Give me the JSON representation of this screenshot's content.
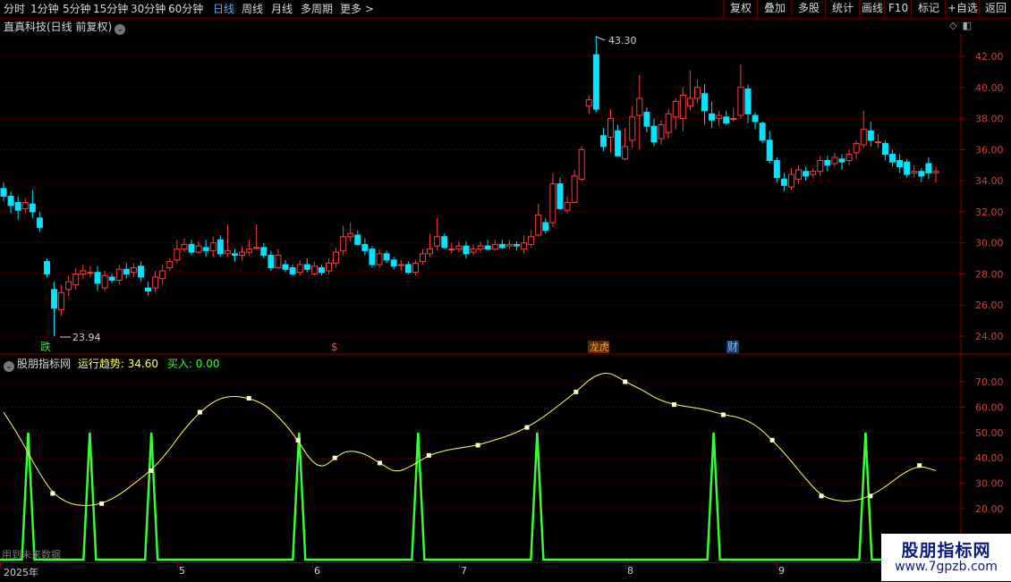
{
  "toolbar": {
    "periods": [
      "分时",
      "1分钟",
      "5分钟",
      "15分钟",
      "30分钟",
      "60分钟",
      "日线",
      "周线",
      "月线",
      "多周期",
      "更多 >"
    ],
    "active_period": "日线",
    "right_buttons": [
      "复权",
      "叠加",
      "多股",
      "统计",
      "画线",
      "F10",
      "+自选",
      "返回"
    ],
    "marker_btn": "标记"
  },
  "chart_title": "直真科技(日线 前复权)",
  "price_axis": {
    "labels": [
      "42.00",
      "40.00",
      "38.00",
      "36.00",
      "34.00",
      "32.00",
      "30.00",
      "28.00",
      "26.00",
      "24.00"
    ]
  },
  "annotations": {
    "high": "43.30",
    "low": "23.94"
  },
  "event_markers": {
    "m1": "跌",
    "m2": "$",
    "m3": "龙虎",
    "m4": "财"
  },
  "indicator": {
    "name": "股朋指标网",
    "trend_label": "运行趋势: 34.60",
    "buy_label": "买入: 0.00",
    "axis_labels": [
      "70.00",
      "60.00",
      "50.00",
      "40.00",
      "30.00",
      "20.00"
    ],
    "colors": {
      "trend": "#ffff66",
      "buy": "#33ff33"
    }
  },
  "future_note": "用到未来数据",
  "date_axis": {
    "labels": [
      "2025年",
      "5",
      "6",
      "7",
      "8",
      "9"
    ]
  },
  "watermark": {
    "title": "股朋指标网",
    "url": "www.7gpzb.com"
  },
  "chart_data": {
    "type": "candlestick",
    "ylim": [
      23,
      43.5
    ],
    "candles": [
      [
        33.5,
        33.0,
        33.9,
        32.7
      ],
      [
        33.0,
        32.4,
        33.3,
        31.9
      ],
      [
        32.6,
        32.1,
        33.0,
        31.5
      ],
      [
        32.2,
        32.6,
        32.9,
        31.9
      ],
      [
        32.5,
        32.0,
        33.4,
        31.6
      ],
      [
        31.6,
        31.0,
        32.0,
        30.7
      ],
      [
        28.8,
        28.0,
        29.0,
        27.8
      ],
      [
        27.0,
        25.8,
        27.5,
        24.0
      ],
      [
        25.7,
        26.8,
        27.3,
        25.3
      ],
      [
        27.0,
        27.5,
        27.9,
        26.6
      ],
      [
        27.3,
        28.0,
        28.4,
        27.0
      ],
      [
        28.0,
        28.2,
        28.6,
        27.7
      ],
      [
        28.1,
        28.1,
        28.5,
        27.8
      ],
      [
        28.1,
        27.4,
        28.5,
        26.9
      ],
      [
        27.1,
        27.9,
        28.2,
        26.9
      ],
      [
        27.8,
        27.6,
        28.0,
        27.4
      ],
      [
        27.6,
        28.3,
        28.6,
        27.3
      ],
      [
        28.3,
        28.0,
        28.7,
        27.7
      ],
      [
        28.1,
        28.4,
        28.7,
        27.8
      ],
      [
        28.5,
        27.8,
        28.8,
        27.5
      ],
      [
        27.1,
        26.9,
        27.5,
        26.6
      ],
      [
        27.1,
        27.8,
        28.2,
        26.8
      ],
      [
        27.7,
        28.2,
        28.6,
        27.3
      ],
      [
        28.4,
        28.8,
        29.0,
        28.2
      ],
      [
        28.9,
        29.6,
        30.2,
        28.7
      ],
      [
        29.6,
        29.9,
        30.3,
        29.4
      ],
      [
        29.9,
        29.4,
        30.2,
        29.2
      ],
      [
        29.4,
        29.8,
        30.1,
        29.3
      ],
      [
        29.7,
        29.5,
        30.2,
        29.1
      ],
      [
        29.5,
        30.0,
        30.4,
        29.1
      ],
      [
        30.2,
        29.3,
        30.5,
        29.1
      ],
      [
        29.3,
        29.5,
        31.2,
        29.1
      ],
      [
        29.3,
        29.2,
        29.6,
        28.8
      ],
      [
        29.2,
        29.4,
        29.8,
        28.9
      ],
      [
        29.4,
        29.6,
        30.2,
        29.2
      ],
      [
        29.7,
        29.7,
        31.2,
        29.6
      ],
      [
        29.7,
        29.2,
        30.0,
        29.0
      ],
      [
        29.2,
        28.4,
        29.5,
        28.2
      ],
      [
        28.4,
        29.2,
        29.6,
        28.3
      ],
      [
        28.6,
        28.3,
        28.9,
        28.1
      ],
      [
        28.4,
        28.0,
        28.6,
        27.9
      ],
      [
        28.1,
        28.6,
        28.9,
        27.9
      ],
      [
        28.6,
        28.3,
        29.0,
        28.1
      ],
      [
        28.0,
        28.5,
        28.8,
        27.9
      ],
      [
        28.4,
        28.1,
        28.6,
        27.9
      ],
      [
        28.2,
        28.7,
        29.0,
        28.0
      ],
      [
        28.7,
        29.4,
        29.7,
        28.4
      ],
      [
        29.5,
        30.4,
        31.1,
        29.2
      ],
      [
        30.4,
        30.6,
        31.3,
        30.1
      ],
      [
        30.5,
        29.9,
        30.8,
        29.8
      ],
      [
        29.9,
        29.5,
        30.3,
        29.2
      ],
      [
        29.6,
        28.6,
        29.8,
        28.4
      ],
      [
        28.6,
        29.3,
        29.6,
        28.4
      ],
      [
        29.3,
        28.9,
        29.5,
        28.7
      ],
      [
        28.9,
        28.5,
        29.1,
        28.3
      ],
      [
        28.6,
        28.6,
        28.9,
        28.2
      ],
      [
        28.6,
        28.1,
        28.8,
        28.0
      ],
      [
        28.1,
        28.7,
        28.9,
        27.9
      ],
      [
        28.8,
        29.3,
        29.6,
        28.6
      ],
      [
        29.3,
        29.6,
        30.6,
        29.1
      ],
      [
        29.8,
        30.4,
        31.6,
        29.5
      ],
      [
        30.4,
        29.7,
        30.6,
        29.6
      ],
      [
        29.6,
        29.6,
        30.0,
        29.3
      ],
      [
        29.6,
        29.8,
        30.1,
        29.4
      ],
      [
        29.8,
        29.3,
        30.1,
        29.0
      ],
      [
        29.4,
        29.6,
        29.9,
        29.2
      ],
      [
        29.6,
        29.8,
        30.1,
        29.4
      ],
      [
        29.8,
        29.6,
        30.2,
        29.5
      ],
      [
        29.6,
        29.9,
        30.2,
        29.5
      ],
      [
        29.9,
        29.7,
        30.2,
        29.6
      ],
      [
        29.8,
        29.9,
        30.2,
        29.6
      ],
      [
        29.9,
        29.8,
        30.1,
        29.5
      ],
      [
        29.6,
        30.0,
        30.5,
        29.3
      ],
      [
        29.9,
        30.4,
        30.8,
        29.7
      ],
      [
        30.5,
        31.8,
        32.5,
        30.4
      ],
      [
        31.3,
        30.8,
        31.6,
        30.6
      ],
      [
        31.3,
        33.8,
        34.5,
        31.0
      ],
      [
        33.8,
        32.2,
        34.2,
        32.1
      ],
      [
        32.1,
        32.6,
        33.0,
        31.9
      ],
      [
        32.6,
        34.3,
        34.7,
        32.6
      ],
      [
        34.1,
        36.0,
        36.2,
        34.0
      ],
      [
        38.8,
        39.2,
        39.5,
        38.3
      ],
      [
        42.1,
        38.6,
        43.3,
        38.4
      ],
      [
        36.9,
        36.2,
        37.4,
        35.9
      ],
      [
        36.8,
        38.0,
        38.6,
        35.8
      ],
      [
        37.2,
        35.6,
        37.6,
        35.6
      ],
      [
        35.4,
        36.2,
        37.4,
        35.3
      ],
      [
        36.6,
        38.1,
        38.8,
        36.1
      ],
      [
        38.2,
        39.3,
        40.8,
        36.0
      ],
      [
        38.4,
        37.5,
        38.7,
        37.1
      ],
      [
        37.5,
        36.5,
        38.0,
        36.2
      ],
      [
        36.7,
        37.6,
        37.9,
        36.3
      ],
      [
        37.1,
        38.3,
        38.6,
        36.7
      ],
      [
        38.1,
        39.1,
        39.3,
        37.3
      ],
      [
        38.0,
        39.5,
        40.0,
        37.2
      ],
      [
        38.8,
        39.3,
        41.1,
        38.5
      ],
      [
        39.3,
        40.0,
        40.5,
        39.0
      ],
      [
        39.6,
        38.5,
        40.2,
        37.6
      ],
      [
        38.3,
        37.9,
        39.1,
        37.4
      ],
      [
        38.0,
        38.2,
        38.5,
        37.5
      ],
      [
        38.1,
        37.7,
        38.5,
        37.6
      ],
      [
        38.0,
        38.0,
        38.7,
        37.8
      ],
      [
        38.2,
        40.0,
        41.5,
        38.0
      ],
      [
        39.9,
        38.3,
        40.2,
        37.7
      ],
      [
        38.2,
        37.8,
        38.4,
        37.3
      ],
      [
        37.7,
        36.6,
        37.8,
        36.4
      ],
      [
        36.6,
        35.3,
        37.2,
        35.1
      ],
      [
        35.3,
        34.2,
        35.5,
        33.9
      ],
      [
        34.1,
        33.7,
        34.5,
        33.3
      ],
      [
        33.6,
        34.4,
        34.8,
        33.4
      ],
      [
        34.1,
        34.7,
        35.0,
        33.8
      ],
      [
        34.6,
        34.3,
        34.9,
        34.0
      ],
      [
        34.4,
        34.6,
        34.8,
        34.2
      ],
      [
        34.6,
        35.3,
        35.6,
        34.3
      ],
      [
        35.3,
        35.0,
        35.6,
        34.6
      ],
      [
        35.1,
        35.5,
        35.8,
        34.9
      ],
      [
        35.4,
        35.2,
        35.7,
        34.7
      ],
      [
        35.3,
        35.7,
        36.0,
        35.0
      ],
      [
        35.8,
        36.4,
        36.6,
        35.4
      ],
      [
        36.3,
        37.3,
        38.5,
        36.1
      ],
      [
        37.2,
        36.6,
        37.8,
        36.2
      ],
      [
        36.5,
        36.5,
        37.0,
        36.1
      ],
      [
        36.4,
        35.7,
        36.6,
        35.3
      ],
      [
        35.7,
        35.2,
        36.0,
        34.9
      ],
      [
        35.3,
        34.9,
        35.7,
        34.5
      ],
      [
        35.2,
        34.4,
        35.4,
        34.2
      ],
      [
        34.5,
        34.6,
        35.0,
        34.2
      ],
      [
        34.6,
        34.3,
        34.8,
        33.9
      ],
      [
        35.1,
        34.5,
        35.5,
        34.1
      ],
      [
        34.5,
        34.6,
        34.9,
        33.9
      ]
    ],
    "trend_points": [
      [
        0,
        58
      ],
      [
        8,
        48
      ],
      [
        16,
        36
      ],
      [
        24,
        26
      ],
      [
        32,
        22
      ],
      [
        40,
        21
      ],
      [
        48,
        22
      ],
      [
        56,
        25
      ],
      [
        64,
        30
      ],
      [
        72,
        35
      ],
      [
        80,
        42
      ],
      [
        88,
        51
      ],
      [
        96,
        58
      ],
      [
        104,
        63
      ],
      [
        112,
        64.5
      ],
      [
        120,
        63.5
      ],
      [
        128,
        61
      ],
      [
        136,
        55
      ],
      [
        144,
        47
      ],
      [
        150,
        39
      ],
      [
        156,
        36
      ],
      [
        162,
        40
      ],
      [
        168,
        43
      ],
      [
        176,
        42
      ],
      [
        184,
        38
      ],
      [
        192,
        34
      ],
      [
        200,
        37
      ],
      [
        208,
        41
      ],
      [
        216,
        43
      ],
      [
        224,
        44
      ],
      [
        232,
        45
      ],
      [
        240,
        47
      ],
      [
        248,
        49
      ],
      [
        256,
        52
      ],
      [
        264,
        56
      ],
      [
        272,
        61
      ],
      [
        280,
        66
      ],
      [
        288,
        72
      ],
      [
        296,
        74
      ],
      [
        304,
        70
      ],
      [
        312,
        67
      ],
      [
        320,
        63
      ],
      [
        328,
        61
      ],
      [
        336,
        60
      ],
      [
        344,
        59
      ],
      [
        352,
        57
      ],
      [
        360,
        56
      ],
      [
        368,
        53
      ],
      [
        376,
        47
      ],
      [
        384,
        40
      ],
      [
        392,
        32
      ],
      [
        400,
        25
      ],
      [
        408,
        23
      ],
      [
        416,
        23
      ],
      [
        424,
        25
      ],
      [
        432,
        29
      ],
      [
        440,
        34
      ],
      [
        448,
        37
      ],
      [
        456,
        35
      ]
    ],
    "buy_signals": [
      12,
      42,
      72,
      144,
      202,
      260,
      346,
      420
    ]
  }
}
